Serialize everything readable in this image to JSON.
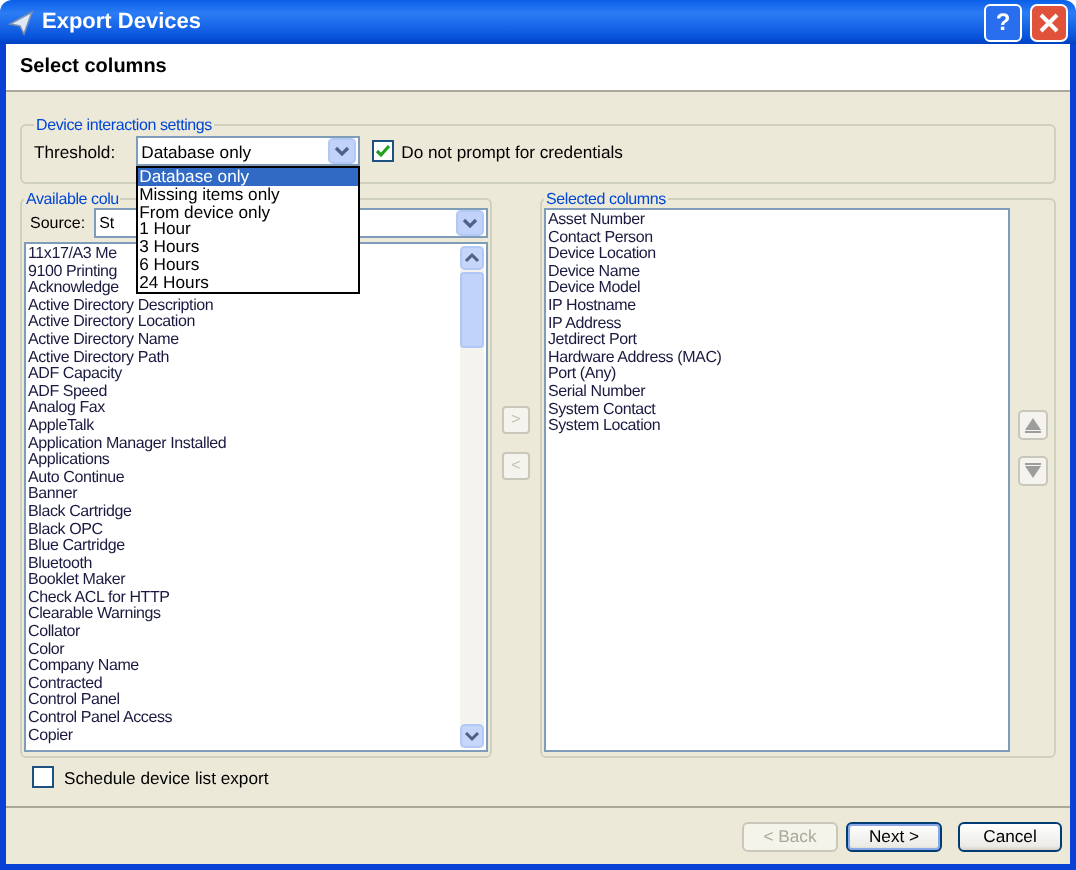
{
  "window": {
    "title": "Export Devices",
    "help": "?"
  },
  "header": {
    "title": "Select columns"
  },
  "interaction": {
    "legend": "Device interaction settings",
    "threshold_label": "Threshold:",
    "threshold_value": "Database only",
    "dropdown_expanded": true,
    "options": [
      {
        "label": "Database only",
        "selected": true
      },
      {
        "label": "Missing items only",
        "selected": false
      },
      {
        "label": "From device only",
        "selected": false
      },
      {
        "label": "1 Hour",
        "selected": false
      },
      {
        "label": "3 Hours",
        "selected": false
      },
      {
        "label": "6 Hours",
        "selected": false
      },
      {
        "label": "24 Hours",
        "selected": false
      }
    ],
    "no_prompt": {
      "label": "Do not prompt for credentials",
      "checked": true
    }
  },
  "available": {
    "legend": "Available colu",
    "source_label": "Source:",
    "source_value": "St",
    "items": [
      "11x17/A3 Me",
      "9100 Printing",
      "Acknowledge",
      "Active Directory Description",
      "Active Directory Location",
      "Active Directory Name",
      "Active Directory Path",
      "ADF Capacity",
      "ADF Speed",
      "Analog Fax",
      "AppleTalk",
      "Application Manager Installed",
      "Applications",
      "Auto Continue",
      "Banner",
      "Black Cartridge",
      "Black OPC",
      "Blue Cartridge",
      "Bluetooth",
      "Booklet Maker",
      "Check ACL for HTTP",
      "Clearable Warnings",
      "Collator",
      "Color",
      "Company Name",
      "Contracted",
      "Control Panel",
      "Control Panel Access",
      "Copier"
    ]
  },
  "move_buttons": [
    {
      "label": ">",
      "disabled": true
    },
    {
      "label": "<",
      "disabled": true
    }
  ],
  "selected": {
    "legend": "Selected columns",
    "items": [
      "Asset Number",
      "Contact Person",
      "Device Location",
      "Device Name",
      "Device Model",
      "IP Hostname",
      "IP Address",
      "Jetdirect Port",
      "Hardware Address (MAC)",
      "Port (Any)",
      "Serial Number",
      "System Contact",
      "System Location"
    ]
  },
  "schedule": {
    "label": "Schedule device list export",
    "checked": false
  },
  "buttons": [
    {
      "label": "< Back",
      "disabled": true,
      "default": false
    },
    {
      "label": "Next >",
      "disabled": false,
      "default": true
    },
    {
      "label": "Cancel",
      "disabled": false,
      "default": false
    }
  ]
}
